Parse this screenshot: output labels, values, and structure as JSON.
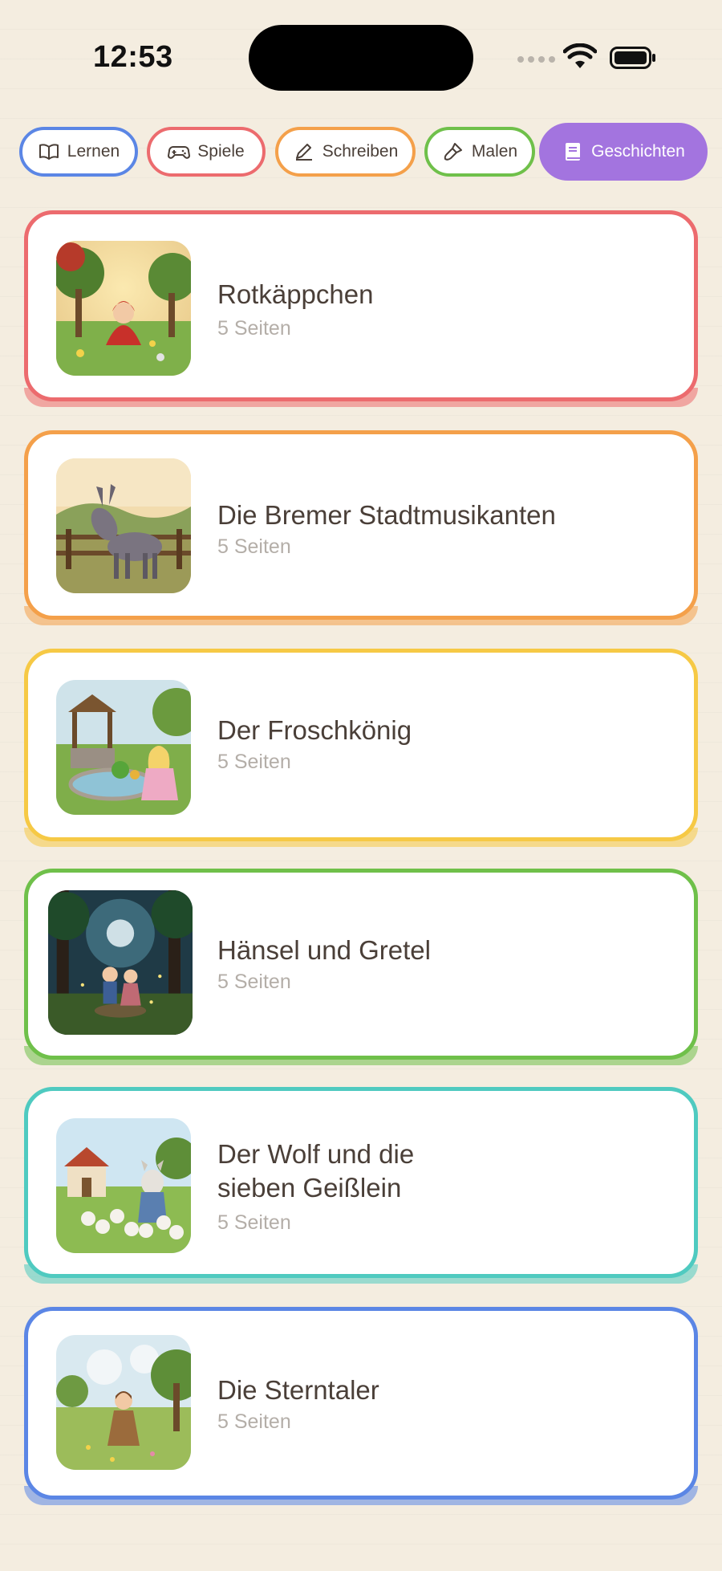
{
  "status_bar": {
    "time": "12:53"
  },
  "tabs": [
    {
      "label": "Lernen",
      "icon": "book-open-icon",
      "color": "#5b86e5"
    },
    {
      "label": "Spiele",
      "icon": "gamepad-icon",
      "color": "#ec6b6e"
    },
    {
      "label": "Schreiben",
      "icon": "pencil-icon",
      "color": "#f4a04a"
    },
    {
      "label": "Malen",
      "icon": "paintbrush-icon",
      "color": "#6fc04a"
    },
    {
      "label": "Geschichten",
      "icon": "book-icon",
      "color": "#a374df",
      "active": true
    }
  ],
  "stories": [
    {
      "title": "Rotkäppchen",
      "pages": "5 Seiten",
      "color": "#ec6b6e",
      "image": "little-red-riding-hood-image"
    },
    {
      "title": "Die Bremer Stadtmusikanten",
      "pages": "5 Seiten",
      "color": "#f4a04a",
      "image": "donkey-image"
    },
    {
      "title": "Der Froschkönig",
      "pages": "5 Seiten",
      "color": "#f6c945",
      "image": "frog-prince-image"
    },
    {
      "title": "Hänsel und Gretel",
      "pages": "5 Seiten",
      "color": "#6fc04a",
      "image": "hansel-gretel-image"
    },
    {
      "title_line1": "Der Wolf und die",
      "title_line2": "sieben Geißlein",
      "pages": "5 Seiten",
      "color": "#4fcac0",
      "image": "wolf-seven-goats-image"
    },
    {
      "title": "Die Sterntaler",
      "pages": "5 Seiten",
      "color": "#5b86e5",
      "image": "star-money-image"
    }
  ]
}
